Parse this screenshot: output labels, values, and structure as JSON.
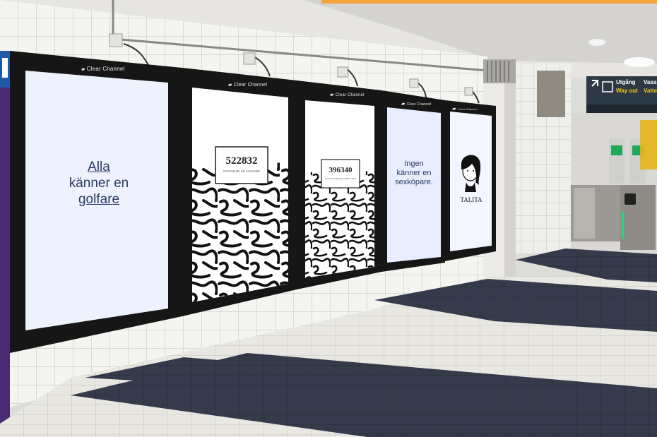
{
  "brand": "Clear Channel",
  "screens": {
    "s1": {
      "line1": "Alla",
      "line2": "känner en",
      "line3": "golfare"
    },
    "s2": {
      "number": "522832",
      "caption": "SVENSKAR ÄR GOLFARE"
    },
    "s3": {
      "number": "396340",
      "caption": "SVENSKAR HAR KÖPT SEX"
    },
    "s4": {
      "line1": "Ingen",
      "line2": "känner en",
      "line3": "sexköpare."
    },
    "s5": {
      "name": "TALITA"
    }
  },
  "sign": {
    "exit_sv": "Utgång",
    "exit_en": "Way out",
    "street1": "Vasa",
    "street2": "Vatte"
  },
  "colors": {
    "accent": "#f2a33a",
    "sign_bg": "#2d3a45",
    "sign_yellow": "#f5c518",
    "screen_bg": "#eef2ff"
  }
}
